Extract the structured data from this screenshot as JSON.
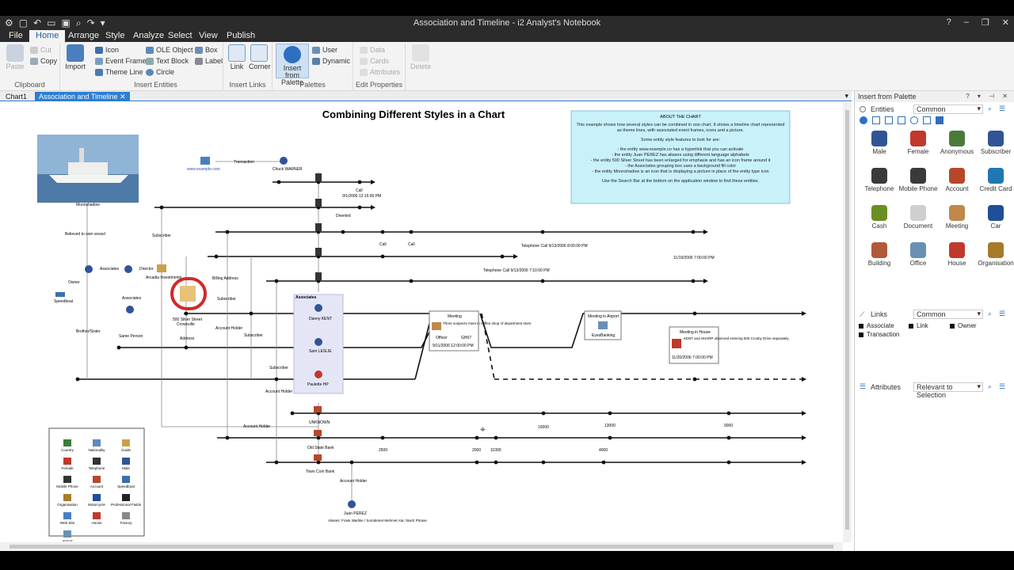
{
  "window": {
    "title": "Association and Timeline - i2 Analyst's Notebook",
    "controls": [
      "?",
      "–",
      "❐",
      "✕"
    ]
  },
  "menu": {
    "tabs": [
      "File",
      "Home",
      "Arrange",
      "Style",
      "Analyze",
      "Select",
      "View",
      "Publish"
    ],
    "active": "Home"
  },
  "ribbon": {
    "clipboard": {
      "paste": "Paste",
      "cut": "Cut",
      "copy": "Copy",
      "label": "Clipboard"
    },
    "import": "Import",
    "insert_entities": {
      "icon": "Icon",
      "ole": "OLE Object",
      "box": "Box",
      "event_frame": "Event Frame",
      "text_block": "Text Block",
      "label_item": "Label",
      "theme_line": "Theme Line",
      "circle": "Circle",
      "label": "Insert Entities"
    },
    "insert_links": {
      "link": "Link",
      "corner": "Corner",
      "label": "Insert Links"
    },
    "palettes": {
      "insert_from_palette": "Insert from Palette",
      "user": "User",
      "dynamic": "Dynamic",
      "label": "Palettes"
    },
    "edit_properties": {
      "data": "Data",
      "cards": "Cards",
      "attributes": "Attributes",
      "label": "Edit Properties"
    },
    "delete": "Delete"
  },
  "doc_tabs": [
    {
      "label": "Chart1",
      "active": false
    },
    {
      "label": "Association and Timeline",
      "active": true,
      "close": "✕"
    }
  ],
  "chart": {
    "title": "Combining Different Styles in a Chart",
    "about": {
      "heading": "ABOUT THE CHART",
      "intro": "This example shows how several styles can be combined in one chart. It shows a timeline chart represented as theme lines, with associated event frames, icons and a picture.",
      "features_heading": "Some entity style features to look for are:",
      "features": [
        "- the entity www.example.co has a hyperlink that you can activate",
        "- the entity Juan PEREZ has aliases using different language alphabets",
        "- the entity 500 Silver Street has been enlarged for emphasis and has an icon frame around it",
        "- the Associates grouping box uses a background fill color",
        "- the entity Moonshadow is an icon that is displaying a picture in place of the entity type icon"
      ],
      "footer": "Use the Search Bar at the bottom on the application window to find these entities."
    },
    "labels": {
      "moonshadow": "Moonshadow",
      "believed": "Believed to own vessel",
      "example_link": "www.example.com",
      "transaction": "Transaction",
      "chuck": "Chuck WARNER",
      "subscriber": "Subscriber",
      "associates": "Associates",
      "director": "Director",
      "arcadia": "Arcadia Investments",
      "owner": "Owner",
      "speedboat": "Speedboat",
      "brother": "Brother/Sister",
      "same_person": "Same Person",
      "silver": "500 Silver Street",
      "crowsville": "Crowsville",
      "address": "Address",
      "billing": "Billing Address",
      "account_holder": "Account Holder",
      "danny": "Danny KENT",
      "sam": "Sam LESLIE",
      "paulette": "Paulette HP",
      "meeting": "Meeting",
      "meeting_text": "Three suspects meet in coffee shop of department store",
      "officer": "Officer",
      "gh67": "GH67",
      "meeting_date": "9/11/2006 12:00:00 PM",
      "airport": "Meeting in Airport",
      "eyesbanking": "EyesBanking",
      "house": "Meeting in House",
      "house_text": "KENT and SHARP observed entering 500 Crosby Drive separately",
      "house_date": "11/20/2006 7:00:00 PM",
      "tel_call1": "Telephone Call 9/13/2006 8:00:00 PM",
      "tel_call2": "Telephone Call 9/13/2006 7:10:00 PM",
      "date_far": "11/19/2006 7:00:00 PM",
      "call": "Call",
      "diverted": "Diverted",
      "call_time": "9/1/2006 12:15:00 PM",
      "unknown": "UNKNOWN",
      "old_state": "Old State Bank",
      "town_coin": "Town Coin Bank",
      "juan": "Juan PEREZ",
      "juan_alias": "Aliases: Frank Warlike / Somdemet Mehmet Ata / Bach Phrase",
      "legend_title": "Combining Different Styles in a Chart",
      "amounts": [
        "2500",
        "2000",
        "11000",
        "10000",
        "4000",
        "13000",
        "9000"
      ]
    },
    "legend_items": [
      "Country",
      "Nationality",
      "Guide",
      "Female",
      "Telephone",
      "Male",
      "Mobile Phone",
      "Account",
      "Speedboat",
      "Organisation",
      "Motorcycle",
      "Professional Fields",
      "Web Site",
      "House",
      "Factory",
      "Airport"
    ]
  },
  "panel": {
    "title": "Insert from Palette",
    "entities_label": "Entities",
    "entities_combo": "Common",
    "entities": [
      {
        "label": "Male",
        "color": "#2f5597"
      },
      {
        "label": "Female",
        "color": "#c0392b"
      },
      {
        "label": "Anonymous",
        "color": "#4a7a3a"
      },
      {
        "label": "Subscriber",
        "color": "#2f5597"
      },
      {
        "label": "Telephone",
        "color": "#3a3a3a"
      },
      {
        "label": "Mobile Phone",
        "color": "#3a3a3a"
      },
      {
        "label": "Account",
        "color": "#b7472a"
      },
      {
        "label": "Credit Card",
        "color": "#1f77b4"
      },
      {
        "label": "Cash",
        "color": "#6b8e23"
      },
      {
        "label": "Document",
        "color": "#cfcfcf"
      },
      {
        "label": "Meeting",
        "color": "#c0884a"
      },
      {
        "label": "Car",
        "color": "#1f4e9a"
      },
      {
        "label": "Building",
        "color": "#b05a3a"
      },
      {
        "label": "Office",
        "color": "#6a8fb5"
      },
      {
        "label": "House",
        "color": "#c0392b"
      },
      {
        "label": "Organisation",
        "color": "#a67c2a"
      }
    ],
    "links_label": "Links",
    "links_combo": "Common",
    "links": [
      "Associate",
      "Link",
      "Owner",
      "Transaction"
    ],
    "attributes_label": "Attributes",
    "attributes_combo": "Relevant to Selection"
  }
}
